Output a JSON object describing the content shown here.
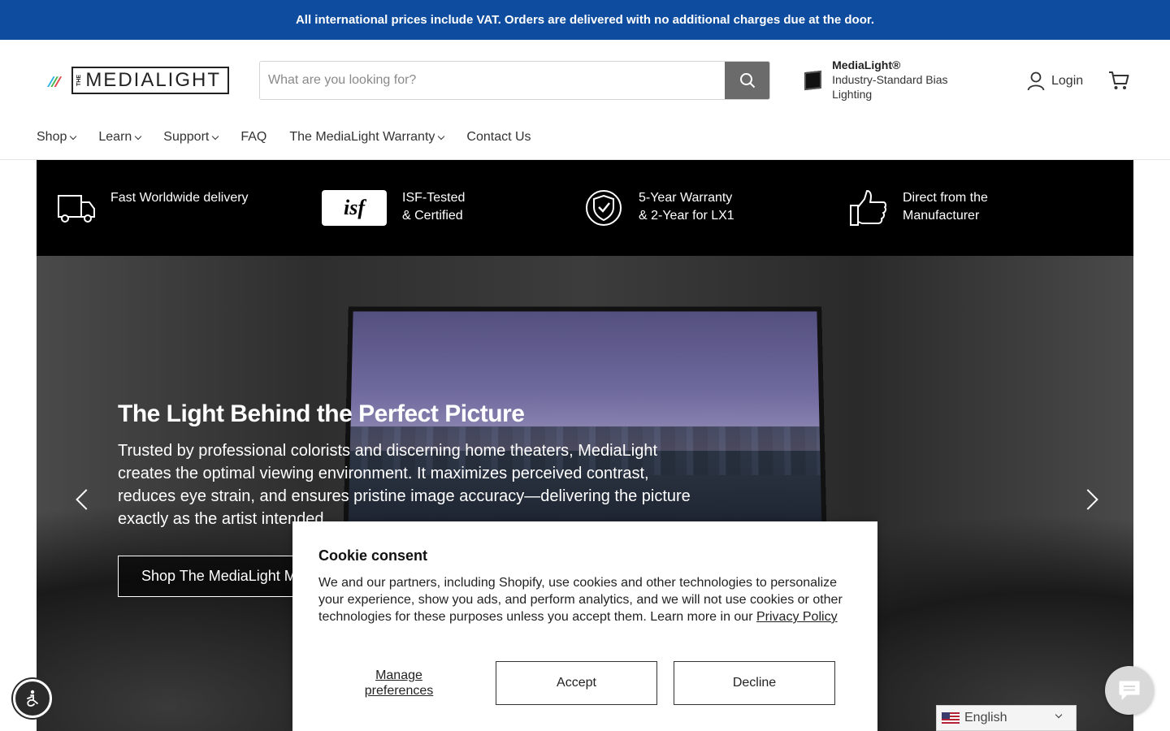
{
  "announcement": "All international prices include VAT. Orders are delivered with no additional charges due at the door.",
  "header": {
    "logo_text": "MEDIALIGHT",
    "logo_the": "THE",
    "search_placeholder": "What are you looking for?",
    "promo_title": "MediaLight®",
    "promo_subtitle": "Industry-Standard Bias Lighting",
    "login_label": "Login"
  },
  "nav": {
    "items": [
      {
        "label": "Shop"
      },
      {
        "label": "Learn"
      },
      {
        "label": "Support"
      },
      {
        "label": "FAQ"
      },
      {
        "label": "The MediaLight Warranty"
      },
      {
        "label": "Contact Us"
      }
    ]
  },
  "features": [
    {
      "line1": "Fast Worldwide delivery",
      "line2": ""
    },
    {
      "line1": "ISF-Tested",
      "line2": "& Certified",
      "badge": "isf"
    },
    {
      "line1": "5-Year Warranty",
      "line2": "& 2-Year for LX1"
    },
    {
      "line1": "Direct from the",
      "line2": "Manufacturer"
    }
  ],
  "hero": {
    "title": "The Light Behind the Perfect Picture",
    "description": "Trusted by professional colorists and discerning home theaters, MediaLight creates the optimal viewing environment. It maximizes perceived contrast, reduces eye strain, and ensures pristine image accuracy—delivering the picture exactly as the artist intended.",
    "button_label": "Shop The MediaLight M"
  },
  "cookie": {
    "title": "Cookie consent",
    "body": "We and our partners, including Shopify, use cookies and other technologies to personalize your experience, show you ads, and perform analytics, and we will not use cookies or other technologies for these purposes unless you accept them. Learn more in our ",
    "privacy_link": "Privacy Policy",
    "manage_label": "Manage preferences",
    "accept_label": "Accept",
    "decline_label": "Decline"
  },
  "language": {
    "selected": "English"
  },
  "colors": {
    "announcement_bg": "#0d4c9e",
    "search_button": "#6b6b6b",
    "feature_bar": "#000000"
  }
}
